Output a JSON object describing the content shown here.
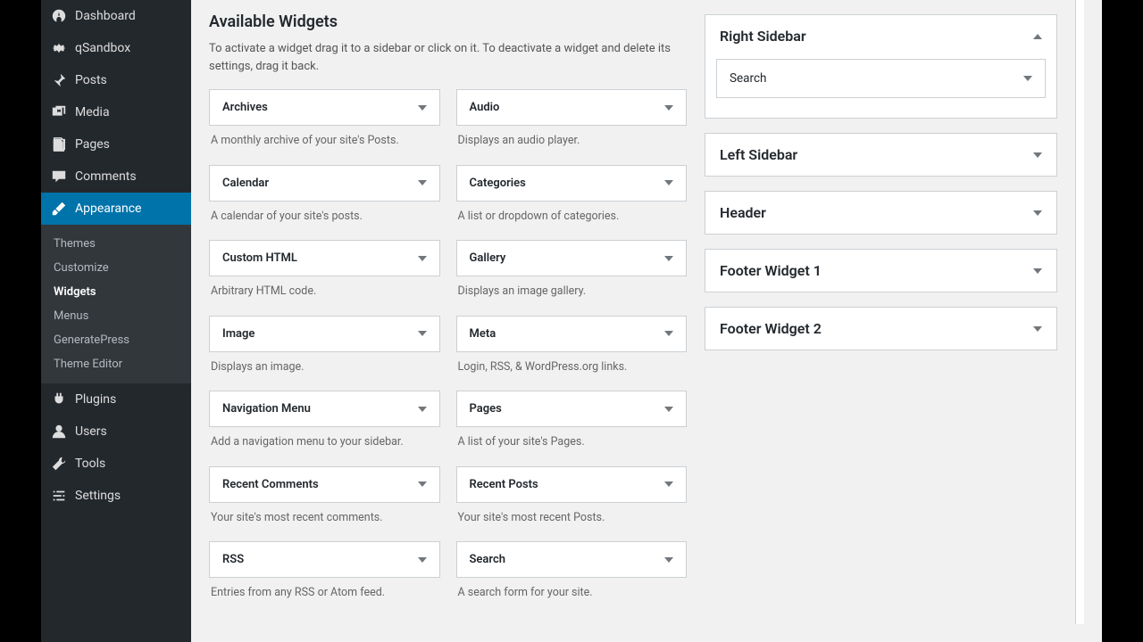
{
  "sidebar": {
    "items": [
      {
        "label": "Dashboard",
        "icon": "dashboard"
      },
      {
        "label": "qSandbox",
        "icon": "gear"
      },
      {
        "label": "Posts",
        "icon": "pin"
      },
      {
        "label": "Media",
        "icon": "media"
      },
      {
        "label": "Pages",
        "icon": "page"
      },
      {
        "label": "Comments",
        "icon": "comment"
      },
      {
        "label": "Appearance",
        "icon": "brush",
        "active": true
      },
      {
        "label": "Plugins",
        "icon": "plugin"
      },
      {
        "label": "Users",
        "icon": "user"
      },
      {
        "label": "Tools",
        "icon": "tools"
      },
      {
        "label": "Settings",
        "icon": "settings"
      }
    ],
    "submenu": [
      {
        "label": "Themes"
      },
      {
        "label": "Customize"
      },
      {
        "label": "Widgets",
        "current": true
      },
      {
        "label": "Menus"
      },
      {
        "label": "GeneratePress"
      },
      {
        "label": "Theme Editor"
      }
    ]
  },
  "available": {
    "title": "Available Widgets",
    "desc": "To activate a widget drag it to a sidebar or click on it. To deactivate a widget and delete its settings, drag it back.",
    "left": [
      {
        "title": "Archives",
        "desc": "A monthly archive of your site's Posts."
      },
      {
        "title": "Calendar",
        "desc": "A calendar of your site's posts."
      },
      {
        "title": "Custom HTML",
        "desc": "Arbitrary HTML code."
      },
      {
        "title": "Image",
        "desc": "Displays an image."
      },
      {
        "title": "Navigation Menu",
        "desc": "Add a navigation menu to your sidebar."
      },
      {
        "title": "Recent Comments",
        "desc": "Your site's most recent comments."
      },
      {
        "title": "RSS",
        "desc": "Entries from any RSS or Atom feed."
      }
    ],
    "right": [
      {
        "title": "Audio",
        "desc": "Displays an audio player."
      },
      {
        "title": "Categories",
        "desc": "A list or dropdown of categories."
      },
      {
        "title": "Gallery",
        "desc": "Displays an image gallery."
      },
      {
        "title": "Meta",
        "desc": "Login, RSS, & WordPress.org links."
      },
      {
        "title": "Pages",
        "desc": "A list of your site's Pages."
      },
      {
        "title": "Recent Posts",
        "desc": "Your site's most recent Posts."
      },
      {
        "title": "Search",
        "desc": "A search form for your site."
      }
    ]
  },
  "areas": [
    {
      "title": "Right Sidebar",
      "open": true,
      "widgets": [
        {
          "title": "Search"
        }
      ]
    },
    {
      "title": "Left Sidebar"
    },
    {
      "title": "Header"
    },
    {
      "title": "Footer Widget 1"
    },
    {
      "title": "Footer Widget 2"
    }
  ]
}
